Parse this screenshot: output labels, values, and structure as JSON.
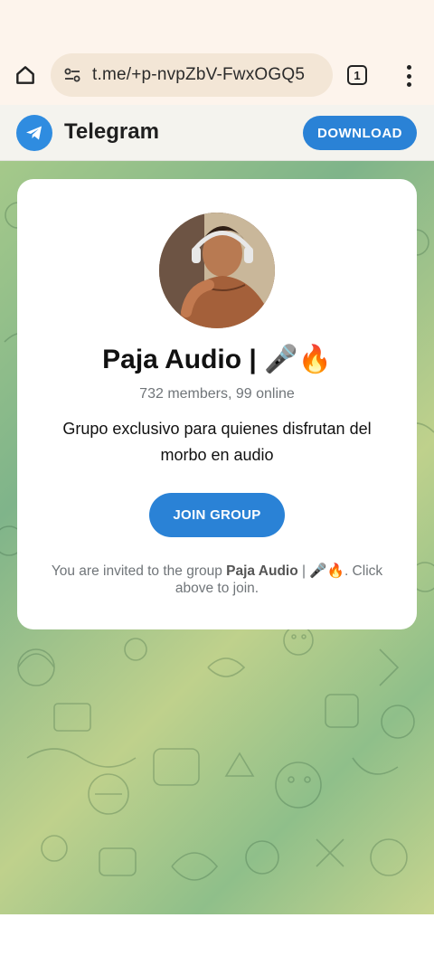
{
  "browser": {
    "url": "t.me/+p-nvpZbV-FwxOGQ5",
    "tab_count": "1"
  },
  "header": {
    "brand": "Telegram",
    "download_label": "DOWNLOAD"
  },
  "group": {
    "title": "Paja Audio | 🎤🔥",
    "members": "732 members, 99 online",
    "description": "Grupo exclusivo para quienes disfrutan del morbo en audio",
    "join_label": "JOIN GROUP",
    "invite_prefix": "You are invited to the group ",
    "invite_name": "Paja Audio",
    "invite_suffix": " | 🎤🔥. Click above to join."
  },
  "colors": {
    "accent": "#2a82d6",
    "browser_bar": "#fdf4ec",
    "url_pill": "#f3e6d6"
  },
  "icons": {
    "home": "home-icon",
    "site_settings": "tune-icon",
    "tabs": "tabs-icon",
    "menu": "more-vert-icon",
    "logo": "telegram-logo-icon"
  }
}
